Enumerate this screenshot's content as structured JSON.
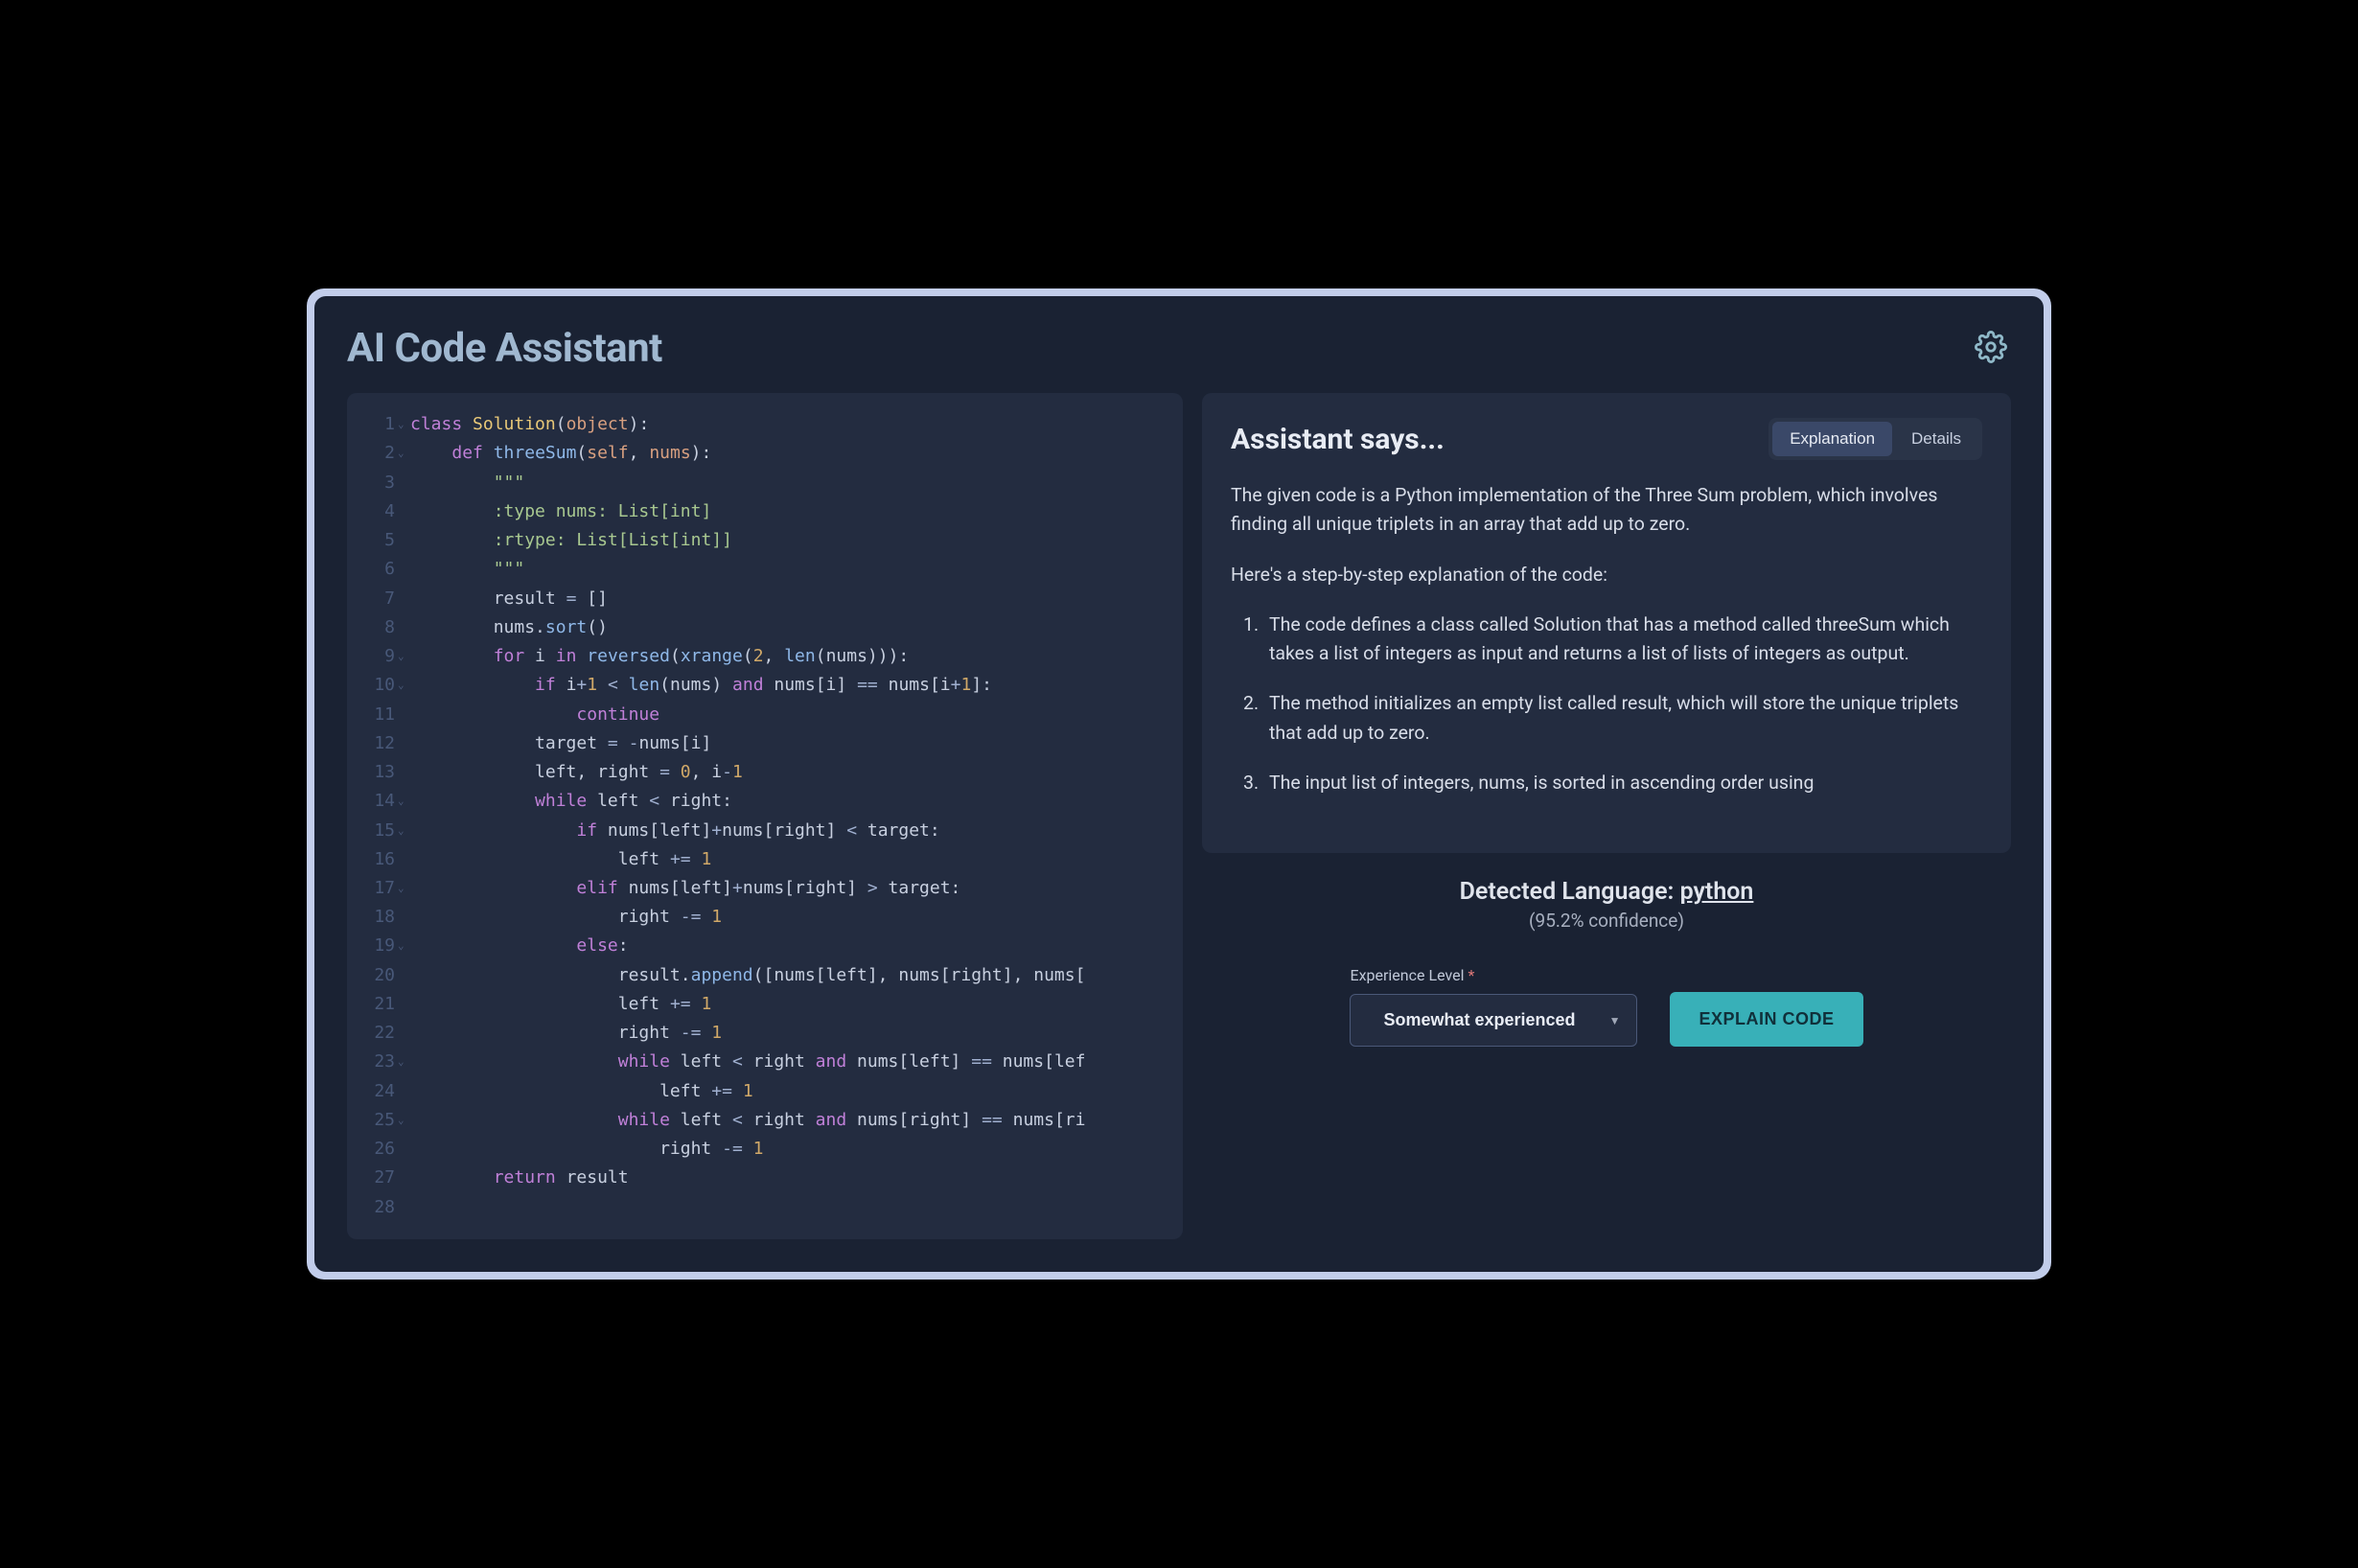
{
  "header": {
    "title": "AI Code Assistant"
  },
  "code": {
    "lines": [
      {
        "n": 1,
        "fold": true,
        "tokens": [
          [
            "kw",
            "class"
          ],
          [
            "pun",
            " "
          ],
          [
            "cls",
            "Solution"
          ],
          [
            "pun",
            "("
          ],
          [
            "param",
            "object"
          ],
          [
            "pun",
            "):"
          ]
        ]
      },
      {
        "n": 2,
        "fold": true,
        "tokens": [
          [
            "pun",
            "    "
          ],
          [
            "kw",
            "def"
          ],
          [
            "pun",
            " "
          ],
          [
            "fn",
            "threeSum"
          ],
          [
            "pun",
            "("
          ],
          [
            "param",
            "self"
          ],
          [
            "pun",
            ", "
          ],
          [
            "param",
            "nums"
          ],
          [
            "pun",
            "):"
          ]
        ]
      },
      {
        "n": 3,
        "fold": false,
        "tokens": [
          [
            "pun",
            "        "
          ],
          [
            "str",
            "\"\"\""
          ]
        ]
      },
      {
        "n": 4,
        "fold": false,
        "tokens": [
          [
            "pun",
            "        "
          ],
          [
            "str",
            ":type nums: List[int]"
          ]
        ]
      },
      {
        "n": 5,
        "fold": false,
        "tokens": [
          [
            "pun",
            "        "
          ],
          [
            "str",
            ":rtype: List[List[int]]"
          ]
        ]
      },
      {
        "n": 6,
        "fold": false,
        "tokens": [
          [
            "pun",
            "        "
          ],
          [
            "str",
            "\"\"\""
          ]
        ]
      },
      {
        "n": 7,
        "fold": false,
        "tokens": [
          [
            "pun",
            "        result "
          ],
          [
            "op",
            "="
          ],
          [
            "pun",
            " []"
          ]
        ]
      },
      {
        "n": 8,
        "fold": false,
        "tokens": [
          [
            "pun",
            "        nums."
          ],
          [
            "fn",
            "sort"
          ],
          [
            "pun",
            "()"
          ]
        ]
      },
      {
        "n": 9,
        "fold": true,
        "tokens": [
          [
            "pun",
            "        "
          ],
          [
            "kw",
            "for"
          ],
          [
            "pun",
            " i "
          ],
          [
            "kw",
            "in"
          ],
          [
            "pun",
            " "
          ],
          [
            "fn",
            "reversed"
          ],
          [
            "pun",
            "("
          ],
          [
            "fn",
            "xrange"
          ],
          [
            "pun",
            "("
          ],
          [
            "num",
            "2"
          ],
          [
            "pun",
            ", "
          ],
          [
            "fn",
            "len"
          ],
          [
            "pun",
            "(nums))):"
          ]
        ]
      },
      {
        "n": 10,
        "fold": true,
        "tokens": [
          [
            "pun",
            "            "
          ],
          [
            "kw",
            "if"
          ],
          [
            "pun",
            " i"
          ],
          [
            "op",
            "+"
          ],
          [
            "num",
            "1"
          ],
          [
            "pun",
            " "
          ],
          [
            "op",
            "<"
          ],
          [
            "pun",
            " "
          ],
          [
            "fn",
            "len"
          ],
          [
            "pun",
            "(nums) "
          ],
          [
            "kw",
            "and"
          ],
          [
            "pun",
            " nums[i] "
          ],
          [
            "op",
            "=="
          ],
          [
            "pun",
            " nums[i"
          ],
          [
            "op",
            "+"
          ],
          [
            "num",
            "1"
          ],
          [
            "pun",
            "]:"
          ]
        ]
      },
      {
        "n": 11,
        "fold": false,
        "tokens": [
          [
            "pun",
            "                "
          ],
          [
            "kw",
            "continue"
          ]
        ]
      },
      {
        "n": 12,
        "fold": false,
        "tokens": [
          [
            "pun",
            "            target "
          ],
          [
            "op",
            "="
          ],
          [
            "pun",
            " "
          ],
          [
            "op",
            "-"
          ],
          [
            "pun",
            "nums[i]"
          ]
        ]
      },
      {
        "n": 13,
        "fold": false,
        "tokens": [
          [
            "pun",
            "            left, right "
          ],
          [
            "op",
            "="
          ],
          [
            "pun",
            " "
          ],
          [
            "num",
            "0"
          ],
          [
            "pun",
            ", i"
          ],
          [
            "op",
            "-"
          ],
          [
            "num",
            "1"
          ]
        ]
      },
      {
        "n": 14,
        "fold": true,
        "tokens": [
          [
            "pun",
            "            "
          ],
          [
            "kw",
            "while"
          ],
          [
            "pun",
            " left "
          ],
          [
            "op",
            "<"
          ],
          [
            "pun",
            " right:"
          ]
        ]
      },
      {
        "n": 15,
        "fold": true,
        "tokens": [
          [
            "pun",
            "                "
          ],
          [
            "kw",
            "if"
          ],
          [
            "pun",
            " nums[left]"
          ],
          [
            "op",
            "+"
          ],
          [
            "pun",
            "nums[right] "
          ],
          [
            "op",
            "<"
          ],
          [
            "pun",
            " target:"
          ]
        ]
      },
      {
        "n": 16,
        "fold": false,
        "tokens": [
          [
            "pun",
            "                    left "
          ],
          [
            "op",
            "+="
          ],
          [
            "pun",
            " "
          ],
          [
            "num",
            "1"
          ]
        ]
      },
      {
        "n": 17,
        "fold": true,
        "tokens": [
          [
            "pun",
            "                "
          ],
          [
            "kw",
            "elif"
          ],
          [
            "pun",
            " nums[left]"
          ],
          [
            "op",
            "+"
          ],
          [
            "pun",
            "nums[right] "
          ],
          [
            "op",
            ">"
          ],
          [
            "pun",
            " target:"
          ]
        ]
      },
      {
        "n": 18,
        "fold": false,
        "tokens": [
          [
            "pun",
            "                    right "
          ],
          [
            "op",
            "-="
          ],
          [
            "pun",
            " "
          ],
          [
            "num",
            "1"
          ]
        ]
      },
      {
        "n": 19,
        "fold": true,
        "tokens": [
          [
            "pun",
            "                "
          ],
          [
            "kw",
            "else"
          ],
          [
            "pun",
            ":"
          ]
        ]
      },
      {
        "n": 20,
        "fold": false,
        "tokens": [
          [
            "pun",
            "                    result."
          ],
          [
            "fn",
            "append"
          ],
          [
            "pun",
            "([nums[left], nums[right], nums["
          ]
        ]
      },
      {
        "n": 21,
        "fold": false,
        "tokens": [
          [
            "pun",
            "                    left "
          ],
          [
            "op",
            "+="
          ],
          [
            "pun",
            " "
          ],
          [
            "num",
            "1"
          ]
        ]
      },
      {
        "n": 22,
        "fold": false,
        "tokens": [
          [
            "pun",
            "                    right "
          ],
          [
            "op",
            "-="
          ],
          [
            "pun",
            " "
          ],
          [
            "num",
            "1"
          ]
        ]
      },
      {
        "n": 23,
        "fold": true,
        "tokens": [
          [
            "pun",
            "                    "
          ],
          [
            "kw",
            "while"
          ],
          [
            "pun",
            " left "
          ],
          [
            "op",
            "<"
          ],
          [
            "pun",
            " right "
          ],
          [
            "kw",
            "and"
          ],
          [
            "pun",
            " nums[left] "
          ],
          [
            "op",
            "=="
          ],
          [
            "pun",
            " nums[lef"
          ]
        ]
      },
      {
        "n": 24,
        "fold": false,
        "tokens": [
          [
            "pun",
            "                        left "
          ],
          [
            "op",
            "+="
          ],
          [
            "pun",
            " "
          ],
          [
            "num",
            "1"
          ]
        ]
      },
      {
        "n": 25,
        "fold": true,
        "tokens": [
          [
            "pun",
            "                    "
          ],
          [
            "kw",
            "while"
          ],
          [
            "pun",
            " left "
          ],
          [
            "op",
            "<"
          ],
          [
            "pun",
            " right "
          ],
          [
            "kw",
            "and"
          ],
          [
            "pun",
            " nums[right] "
          ],
          [
            "op",
            "=="
          ],
          [
            "pun",
            " nums[ri"
          ]
        ]
      },
      {
        "n": 26,
        "fold": false,
        "tokens": [
          [
            "pun",
            "                        right "
          ],
          [
            "op",
            "-="
          ],
          [
            "pun",
            " "
          ],
          [
            "num",
            "1"
          ]
        ]
      },
      {
        "n": 27,
        "fold": false,
        "tokens": [
          [
            "pun",
            "        "
          ],
          [
            "kw",
            "return"
          ],
          [
            "pun",
            " result"
          ]
        ]
      },
      {
        "n": 28,
        "fold": false,
        "tokens": []
      }
    ]
  },
  "assistant": {
    "heading": "Assistant says...",
    "tabs": {
      "explanation": "Explanation",
      "details": "Details",
      "active": "explanation"
    },
    "body": {
      "intro": "The given code is a Python implementation of the Three Sum problem, which involves finding all unique triplets in an array that add up to zero.",
      "lead": "Here's a step-by-step explanation of the code:",
      "steps": [
        "The code defines a class called Solution that has a method called threeSum which takes a list of integers as input and returns a list of lists of integers as output.",
        "The method initializes an empty list called result, which will store the unique triplets that add up to zero.",
        "The input list of integers, nums, is sorted in ascending order using"
      ]
    }
  },
  "detection": {
    "label": "Detected Language:",
    "language": "python",
    "confidence_text": "(95.2% confidence)",
    "confidence_value": 95.2
  },
  "controls": {
    "experience_label": "Experience Level",
    "experience_value": "Somewhat experienced",
    "explain_button": "EXPLAIN CODE"
  }
}
